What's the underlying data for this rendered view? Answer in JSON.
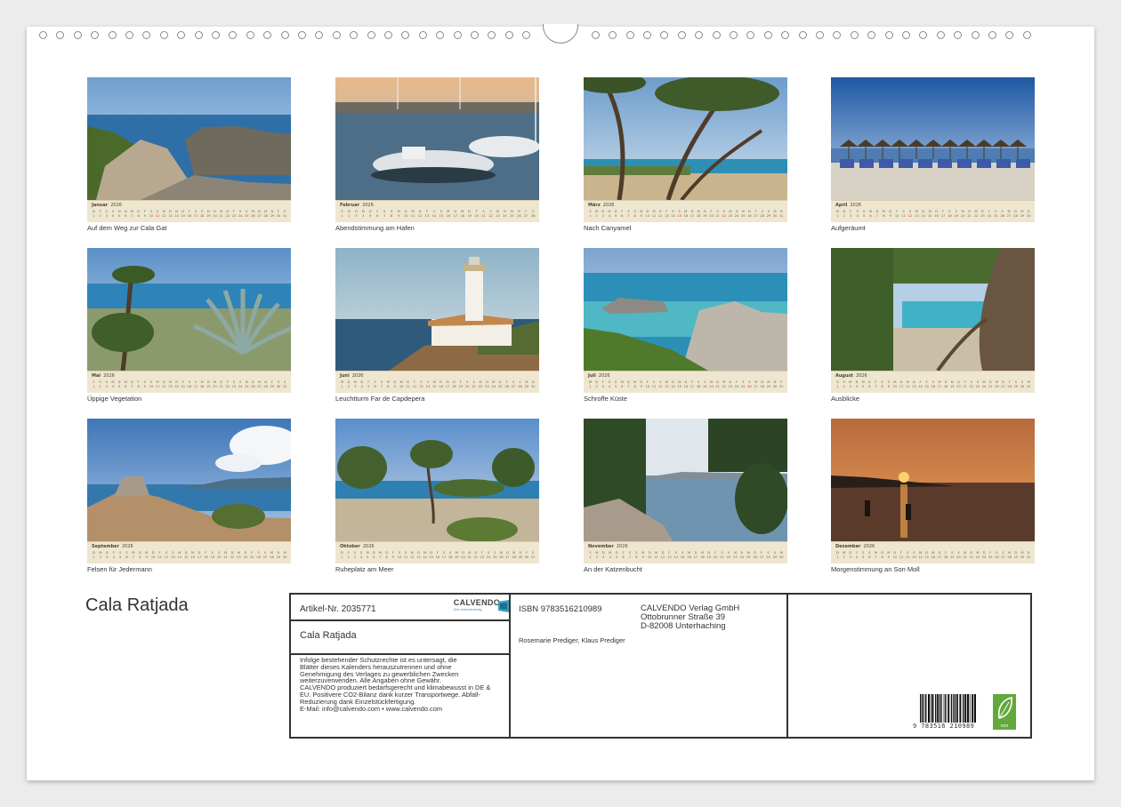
{
  "calendar": {
    "title": "Cala Ratjada",
    "year": "2026",
    "weekdays": [
      "M",
      "D",
      "M",
      "D",
      "F",
      "S",
      "S"
    ],
    "months": [
      {
        "name": "Januar",
        "days": 31,
        "first_weekday": 3,
        "caption": "Auf dem Weg zur Cala Gat",
        "scene": "rocky-coast"
      },
      {
        "name": "Februar",
        "days": 28,
        "first_weekday": 6,
        "caption": "Abendstimmung am Hafen",
        "scene": "harbor"
      },
      {
        "name": "März",
        "days": 31,
        "first_weekday": 6,
        "caption": "Nach Canyamel",
        "scene": "pines-beach"
      },
      {
        "name": "April",
        "days": 30,
        "first_weekday": 2,
        "caption": "Aufgeräumt",
        "scene": "beach-umbrellas"
      },
      {
        "name": "Mai",
        "days": 31,
        "first_weekday": 4,
        "caption": "Üppige Vegetation",
        "scene": "agave"
      },
      {
        "name": "Juni",
        "days": 30,
        "first_weekday": 0,
        "caption": "Leuchtturm Far de Capdepera",
        "scene": "lighthouse"
      },
      {
        "name": "Juli",
        "days": 31,
        "first_weekday": 2,
        "caption": "Schroffe Küste",
        "scene": "turquoise-coast"
      },
      {
        "name": "August",
        "days": 31,
        "first_weekday": 5,
        "caption": "Ausblicke",
        "scene": "tree-view"
      },
      {
        "name": "September",
        "days": 30,
        "first_weekday": 1,
        "caption": "Felsen für Jedermann",
        "scene": "rock-clouds"
      },
      {
        "name": "Oktober",
        "days": 31,
        "first_weekday": 3,
        "caption": "Ruheplatz am Meer",
        "scene": "tamarisk"
      },
      {
        "name": "November",
        "days": 30,
        "first_weekday": 6,
        "caption": "An der Katzenbucht",
        "scene": "bay-pines"
      },
      {
        "name": "Dezember",
        "days": 31,
        "first_weekday": 1,
        "caption": "Morgenstimmung an Son Moll",
        "scene": "sunrise"
      }
    ]
  },
  "info": {
    "article": "Artikel-Nr. 2035771",
    "logo_text": "CALVENDO",
    "logo_subtext": "Dein Kalenderverlag",
    "box_title": "Cala Ratjada",
    "legal_lines": [
      "Infolge bestehender Schutzrechte ist es untersagt, die",
      "Blätter dieses Kalenders herauszutrennen und ohne",
      "Genehmigung des Verlages zu gewerblichen Zwecken",
      "weiterzuverwenden. Alle Angaben ohne Gewähr.",
      "CALVENDO produziert bedarfsgerecht und klimabewusst in DE &",
      "EU. Positivere CO2-Bilanz dank kurzer Transportwege. Abfall-",
      "Reduzierung dank Einzelstückfertigung.",
      "E-Mail: info@calvendo.com • www.calvendo.com"
    ],
    "isbn": "ISBN 9783516210989",
    "authors": "Rosemarie Prediger, Klaus Prediger",
    "publisher_lines": [
      "CALVENDO Verlag GmbH",
      "Ottobrunner Straße 39",
      "D-82008 Unterhaching"
    ],
    "barcode_number": "9   783516   210989",
    "eco_label": "eco"
  },
  "colors": {
    "calendar_strip": "#efe6cf",
    "sunday": "#b23a2a",
    "eco_green": "#62a83c"
  }
}
